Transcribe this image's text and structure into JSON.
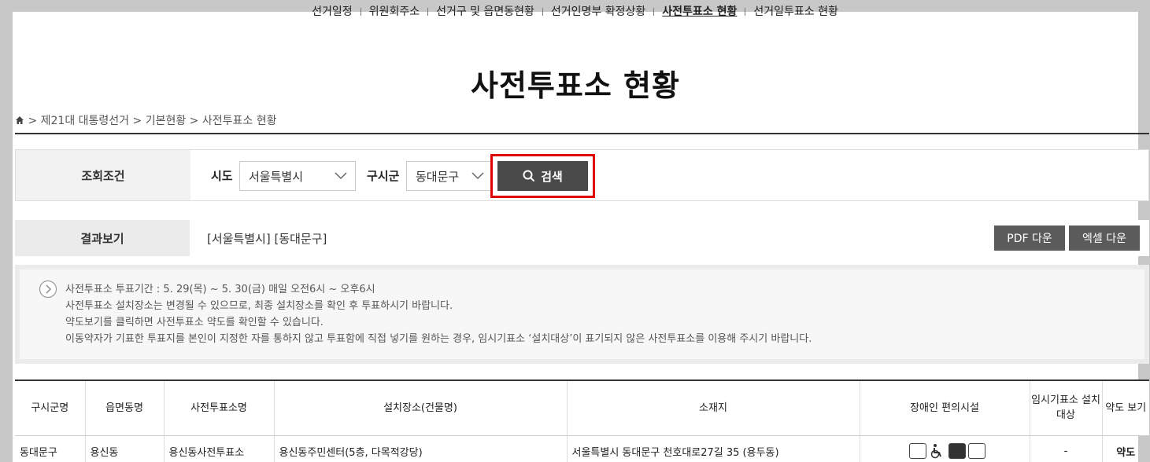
{
  "topnav": [
    {
      "label": "선거일정",
      "active": false
    },
    {
      "label": "위원회주소",
      "active": false
    },
    {
      "label": "선거구 및 읍면동현황",
      "active": false
    },
    {
      "label": "선거인명부 확정상황",
      "active": false
    },
    {
      "label": "사전투표소 현황",
      "active": true
    },
    {
      "label": "선거일투표소 현황",
      "active": false
    }
  ],
  "page_title": "사전투표소 현황",
  "breadcrumb": {
    "text": "> 제21대 대통령선거 > 기본현황 > 사전투표소 현황"
  },
  "search": {
    "label": "조회조건",
    "sido_label": "시도",
    "sido_value": "서울특별시",
    "sigungu_label": "구시군",
    "sigungu_value": "동대문구",
    "button_label": "검색"
  },
  "result": {
    "label": "결과보기",
    "value": "[서울특별시] [동대문구]",
    "pdf_label": "PDF 다운",
    "excel_label": "엑셀 다운"
  },
  "notice": {
    "lines": [
      "사전투표소 투표기간 : 5. 29(목) ~ 5. 30(금) 매일 오전6시 ~ 오후6시",
      "사전투표소 설치장소는 변경될 수 있으므로, 최종 설치장소를 확인 후 투표하시기 바랍니다.",
      "약도보기를 클릭하면 사전투표소 약도를 확인할 수 있습니다.",
      "이동약자가 기표한 투표지를 본인이 지정한 자를 통하지 않고 투표함에 직접 넣기를 원하는 경우, 임시기표소 ‘설치대상’이 표기되지 않은 사전투표소를 이용해 주시기 바랍니다."
    ]
  },
  "table": {
    "headers": [
      "구시군명",
      "읍면동명",
      "사전투표소명",
      "설치장소(건물명)",
      "소재지",
      "장애인 편의시설",
      "임시기표소 설치대상",
      "약도 보기"
    ],
    "rows": [
      {
        "sigungu": "동대문구",
        "dong": "용신동",
        "name": "용신동사전투표소",
        "place": "용신동주민센터(5층, 다목적강당)",
        "address": "서울특별시 동대문구 천호대로27길 35 (용두동)",
        "temp_booth": "-",
        "map": "약도"
      }
    ]
  },
  "icons": {
    "home": "home-icon",
    "search": "search-icon",
    "chevron": "chevron-down-icon",
    "notice": "circle-chevron-right-icon",
    "facilities": [
      "elevator-icon",
      "wheelchair-icon",
      "braille-icon",
      "accessible-toilet-icon"
    ]
  },
  "colors": {
    "highlight": "#e00000",
    "button_dark": "#4a4a4a",
    "download_button": "#5b5b5b"
  }
}
